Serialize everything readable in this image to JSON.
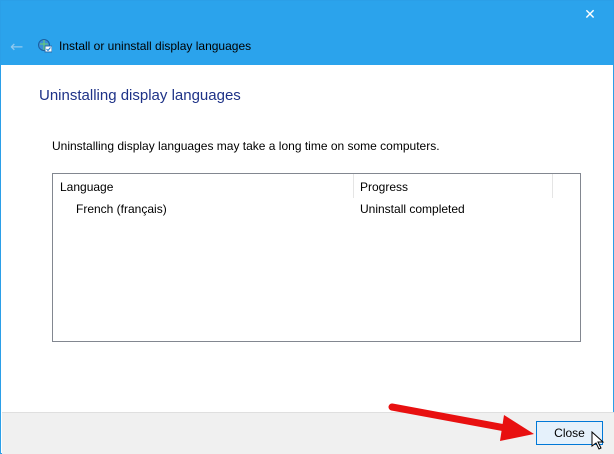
{
  "window": {
    "title": "Install or uninstall display languages"
  },
  "heading": "Uninstalling display languages",
  "description": "Uninstalling display languages may take a long time on some computers.",
  "table": {
    "headers": [
      "Language",
      "Progress"
    ],
    "rows": [
      {
        "language": "French (français)",
        "progress": "Uninstall completed"
      }
    ]
  },
  "footer": {
    "close_label": "Close"
  },
  "colors": {
    "titlebar": "#2ba3ec",
    "heading": "#1e3287",
    "annotation_arrow": "#e81010"
  }
}
